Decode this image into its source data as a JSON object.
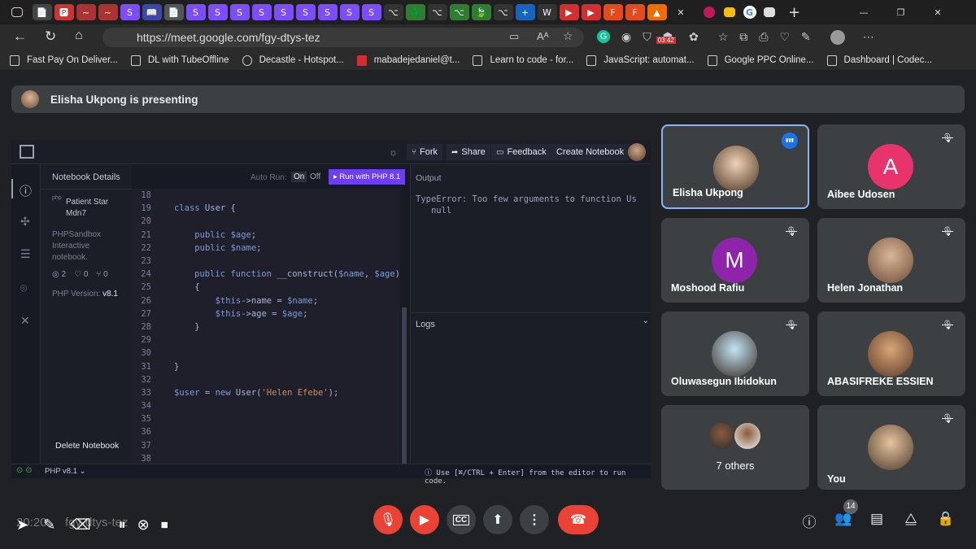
{
  "browser": {
    "url": "https://meet.google.com/fgy-dtys-tez",
    "timer_badge": "03:42",
    "tab_icons": [
      "📄",
      "🅿",
      "~",
      "~",
      "S",
      "📖",
      "📄",
      "S",
      "S",
      "S",
      "S",
      "S",
      "S",
      "S",
      "S",
      "S",
      "⌥",
      "🌲",
      "⌥",
      "⌥",
      "🍃",
      "⌥",
      "+",
      "W",
      "▶",
      "▶",
      "F",
      "F",
      "▲"
    ],
    "bookmarks": [
      {
        "label": "Fast Pay On Deliver...",
        "icon": "page-icon"
      },
      {
        "label": "DL with TubeOffline",
        "icon": "page-icon"
      },
      {
        "label": "Decastle - Hotspot...",
        "icon": "decastle-icon"
      },
      {
        "label": "mabadejedaniel@t...",
        "icon": "gmail-icon"
      },
      {
        "label": "Learn to code - for...",
        "icon": "page-icon"
      },
      {
        "label": "JavaScript: automat...",
        "icon": "page-icon"
      },
      {
        "label": "Google PPC Online...",
        "icon": "page-icon"
      },
      {
        "label": "Dashboard | Codec...",
        "icon": "page-icon"
      }
    ]
  },
  "meet": {
    "presenting_banner": "Elisha Ukpong is presenting",
    "meeting_code_overlay": "fgy-dtys-tez",
    "time_overlay": "20:20",
    "participant_count": "14"
  },
  "notebook": {
    "toolbar": {
      "fork": "Fork",
      "share": "Share",
      "feedback": "Feedback",
      "create": "Create Notebook"
    },
    "details_title": "Notebook Details",
    "php_badge": "php",
    "notebook_name": "Patient Star Mdn7",
    "description": "PHPSandbox Interactive notebook.",
    "stats": {
      "views": "2",
      "likes": "0",
      "forks": "0"
    },
    "php_version_label": "PHP Version:",
    "php_version": "v8.1",
    "delete": "Delete Notebook",
    "auto_run": "Auto Run:",
    "on": "On",
    "off": "Off",
    "run_button": "▸ Run with PHP 8.1",
    "output_title": "Output",
    "output_text": "TypeError: Too few arguments to function Us\n   null",
    "logs_title": "Logs",
    "status_php": "PHP v8.1 ⌄",
    "hint": "ⓘ Use [⌘/CTRL + Enter] from the editor to run code.",
    "code_lines": [
      {
        "n": "18",
        "t": ""
      },
      {
        "n": "19",
        "t": "class User {"
      },
      {
        "n": "20",
        "t": ""
      },
      {
        "n": "21",
        "t": "    public $age;"
      },
      {
        "n": "22",
        "t": "    public $name;"
      },
      {
        "n": "23",
        "t": ""
      },
      {
        "n": "24",
        "t": "    public function __construct($name, $age)"
      },
      {
        "n": "25",
        "t": "    {"
      },
      {
        "n": "26",
        "t": "        $this->name = $name;"
      },
      {
        "n": "27",
        "t": "        $this->age = $age;"
      },
      {
        "n": "28",
        "t": "    }"
      },
      {
        "n": "29",
        "t": ""
      },
      {
        "n": "30",
        "t": ""
      },
      {
        "n": "31",
        "t": "}"
      },
      {
        "n": "32",
        "t": ""
      },
      {
        "n": "33",
        "t": "$user = new User('Helen Efebe');"
      },
      {
        "n": "34",
        "t": ""
      },
      {
        "n": "35",
        "t": ""
      },
      {
        "n": "36",
        "t": ""
      },
      {
        "n": "37",
        "t": ""
      },
      {
        "n": "38",
        "t": ""
      }
    ]
  },
  "participants": [
    {
      "name": "Elisha Ukpong",
      "type": "photo",
      "speaking": true
    },
    {
      "name": "Aibee Udosen",
      "type": "letter",
      "letter": "A",
      "color": "#e8336d",
      "muted": true
    },
    {
      "name": "Moshood Rafiu",
      "type": "letter",
      "letter": "M",
      "color": "#8e24aa",
      "muted": true
    },
    {
      "name": "Helen Jonathan",
      "type": "photo",
      "muted": true
    },
    {
      "name": "Oluwasegun Ibidokun",
      "type": "photo",
      "muted": true
    },
    {
      "name": "ABASIFREKE ESSIEN",
      "type": "photo",
      "muted": true
    },
    {
      "name": "7 others",
      "type": "group"
    },
    {
      "name": "You",
      "type": "photo",
      "muted": true
    }
  ],
  "colors": {
    "accent_blue": "#8ab4f8",
    "end_call_red": "#ea4335",
    "run_purple": "#6d3ff2"
  }
}
